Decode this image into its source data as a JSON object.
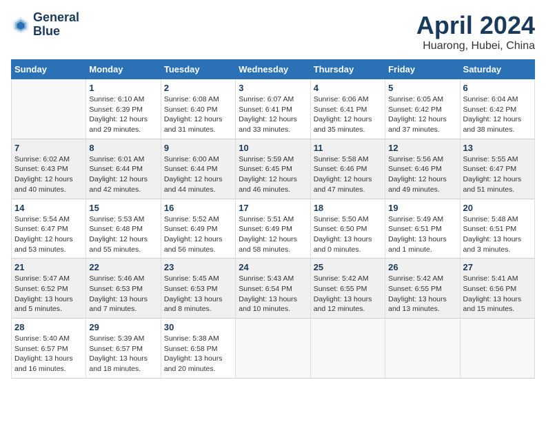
{
  "header": {
    "logo_line1": "General",
    "logo_line2": "Blue",
    "title": "April 2024",
    "subtitle": "Huarong, Hubei, China"
  },
  "calendar": {
    "weekdays": [
      "Sunday",
      "Monday",
      "Tuesday",
      "Wednesday",
      "Thursday",
      "Friday",
      "Saturday"
    ],
    "weeks": [
      [
        {
          "day": "",
          "info": ""
        },
        {
          "day": "1",
          "info": "Sunrise: 6:10 AM\nSunset: 6:39 PM\nDaylight: 12 hours\nand 29 minutes."
        },
        {
          "day": "2",
          "info": "Sunrise: 6:08 AM\nSunset: 6:40 PM\nDaylight: 12 hours\nand 31 minutes."
        },
        {
          "day": "3",
          "info": "Sunrise: 6:07 AM\nSunset: 6:41 PM\nDaylight: 12 hours\nand 33 minutes."
        },
        {
          "day": "4",
          "info": "Sunrise: 6:06 AM\nSunset: 6:41 PM\nDaylight: 12 hours\nand 35 minutes."
        },
        {
          "day": "5",
          "info": "Sunrise: 6:05 AM\nSunset: 6:42 PM\nDaylight: 12 hours\nand 37 minutes."
        },
        {
          "day": "6",
          "info": "Sunrise: 6:04 AM\nSunset: 6:42 PM\nDaylight: 12 hours\nand 38 minutes."
        }
      ],
      [
        {
          "day": "7",
          "info": "Sunrise: 6:02 AM\nSunset: 6:43 PM\nDaylight: 12 hours\nand 40 minutes."
        },
        {
          "day": "8",
          "info": "Sunrise: 6:01 AM\nSunset: 6:44 PM\nDaylight: 12 hours\nand 42 minutes."
        },
        {
          "day": "9",
          "info": "Sunrise: 6:00 AM\nSunset: 6:44 PM\nDaylight: 12 hours\nand 44 minutes."
        },
        {
          "day": "10",
          "info": "Sunrise: 5:59 AM\nSunset: 6:45 PM\nDaylight: 12 hours\nand 46 minutes."
        },
        {
          "day": "11",
          "info": "Sunrise: 5:58 AM\nSunset: 6:46 PM\nDaylight: 12 hours\nand 47 minutes."
        },
        {
          "day": "12",
          "info": "Sunrise: 5:56 AM\nSunset: 6:46 PM\nDaylight: 12 hours\nand 49 minutes."
        },
        {
          "day": "13",
          "info": "Sunrise: 5:55 AM\nSunset: 6:47 PM\nDaylight: 12 hours\nand 51 minutes."
        }
      ],
      [
        {
          "day": "14",
          "info": "Sunrise: 5:54 AM\nSunset: 6:47 PM\nDaylight: 12 hours\nand 53 minutes."
        },
        {
          "day": "15",
          "info": "Sunrise: 5:53 AM\nSunset: 6:48 PM\nDaylight: 12 hours\nand 55 minutes."
        },
        {
          "day": "16",
          "info": "Sunrise: 5:52 AM\nSunset: 6:49 PM\nDaylight: 12 hours\nand 56 minutes."
        },
        {
          "day": "17",
          "info": "Sunrise: 5:51 AM\nSunset: 6:49 PM\nDaylight: 12 hours\nand 58 minutes."
        },
        {
          "day": "18",
          "info": "Sunrise: 5:50 AM\nSunset: 6:50 PM\nDaylight: 13 hours\nand 0 minutes."
        },
        {
          "day": "19",
          "info": "Sunrise: 5:49 AM\nSunset: 6:51 PM\nDaylight: 13 hours\nand 1 minute."
        },
        {
          "day": "20",
          "info": "Sunrise: 5:48 AM\nSunset: 6:51 PM\nDaylight: 13 hours\nand 3 minutes."
        }
      ],
      [
        {
          "day": "21",
          "info": "Sunrise: 5:47 AM\nSunset: 6:52 PM\nDaylight: 13 hours\nand 5 minutes."
        },
        {
          "day": "22",
          "info": "Sunrise: 5:46 AM\nSunset: 6:53 PM\nDaylight: 13 hours\nand 7 minutes."
        },
        {
          "day": "23",
          "info": "Sunrise: 5:45 AM\nSunset: 6:53 PM\nDaylight: 13 hours\nand 8 minutes."
        },
        {
          "day": "24",
          "info": "Sunrise: 5:43 AM\nSunset: 6:54 PM\nDaylight: 13 hours\nand 10 minutes."
        },
        {
          "day": "25",
          "info": "Sunrise: 5:42 AM\nSunset: 6:55 PM\nDaylight: 13 hours\nand 12 minutes."
        },
        {
          "day": "26",
          "info": "Sunrise: 5:42 AM\nSunset: 6:55 PM\nDaylight: 13 hours\nand 13 minutes."
        },
        {
          "day": "27",
          "info": "Sunrise: 5:41 AM\nSunset: 6:56 PM\nDaylight: 13 hours\nand 15 minutes."
        }
      ],
      [
        {
          "day": "28",
          "info": "Sunrise: 5:40 AM\nSunset: 6:57 PM\nDaylight: 13 hours\nand 16 minutes."
        },
        {
          "day": "29",
          "info": "Sunrise: 5:39 AM\nSunset: 6:57 PM\nDaylight: 13 hours\nand 18 minutes."
        },
        {
          "day": "30",
          "info": "Sunrise: 5:38 AM\nSunset: 6:58 PM\nDaylight: 13 hours\nand 20 minutes."
        },
        {
          "day": "",
          "info": ""
        },
        {
          "day": "",
          "info": ""
        },
        {
          "day": "",
          "info": ""
        },
        {
          "day": "",
          "info": ""
        }
      ]
    ]
  }
}
